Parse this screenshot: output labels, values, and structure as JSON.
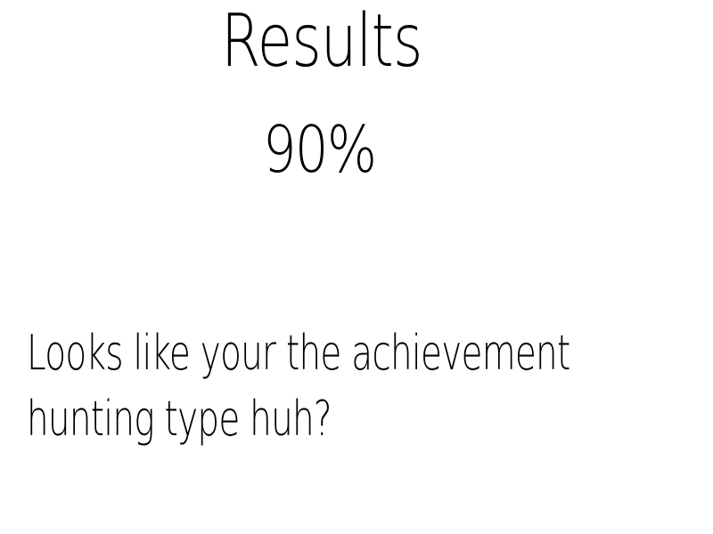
{
  "results": {
    "title": "Results",
    "score": "90%",
    "message_lines": [
      "Looks like your the achievement",
      "hunting type huh?"
    ]
  },
  "colors": {
    "background": "#ffffff",
    "text": "#000000"
  }
}
